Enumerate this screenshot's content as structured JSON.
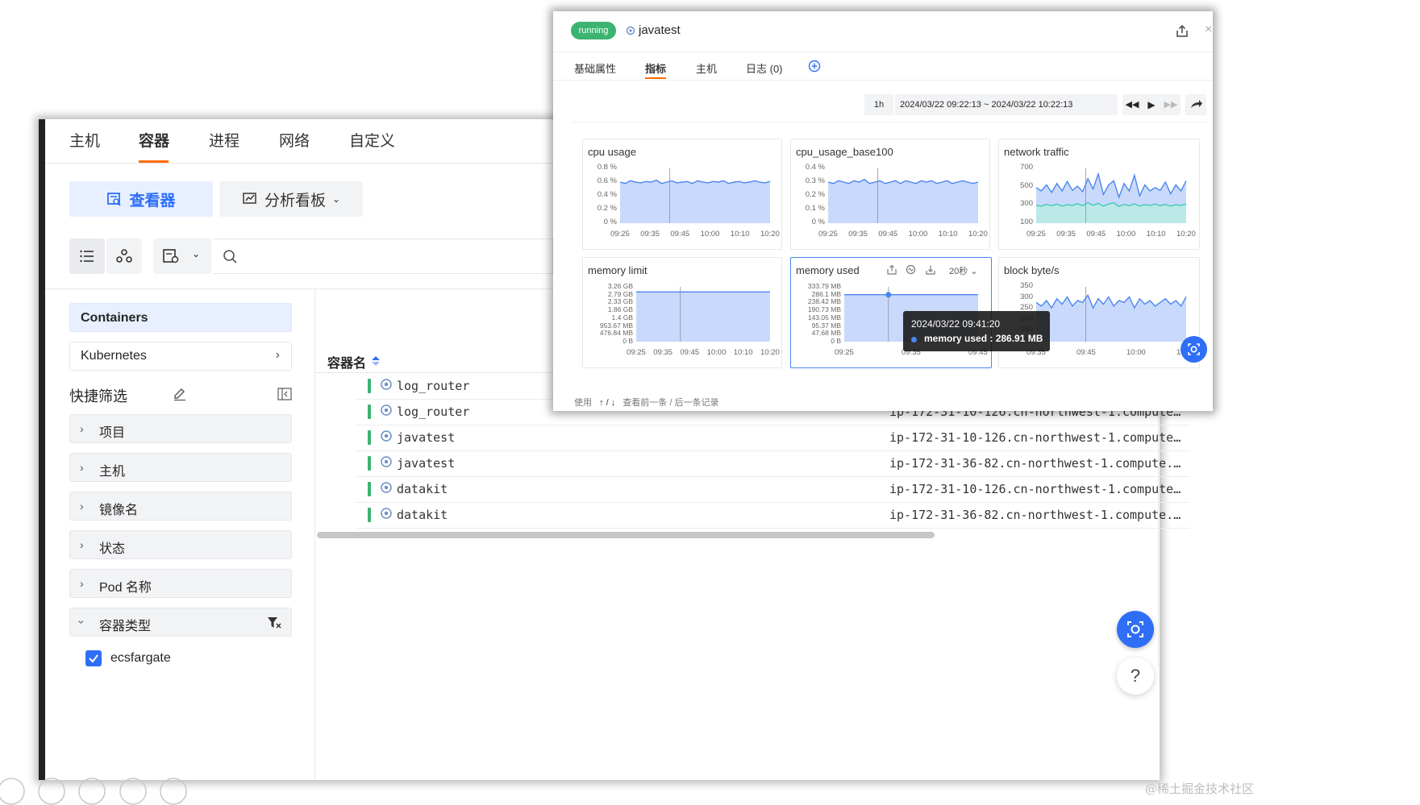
{
  "main": {
    "nav_tabs": [
      "主机",
      "容器",
      "进程",
      "网络",
      "自定义"
    ],
    "active_tab": "容器",
    "viewer_label": "查看器",
    "dashboard_label": "分析看板",
    "sidebar": {
      "section_title": "Containers",
      "kubernetes": "Kubernetes",
      "quick_filter": "快捷筛选",
      "filters": [
        "项目",
        "主机",
        "镜像名",
        "状态",
        "Pod 名称"
      ],
      "container_type": "容器类型",
      "checkbox_label": "ecsfargate",
      "checkbox_checked": true
    },
    "table": {
      "col_name": "容器名",
      "rows": [
        {
          "name": "log_router",
          "host": "ip-172-31-10-126.cn-northwest-1.compute…"
        },
        {
          "name": "log_router",
          "host": "ip-172-31-10-126.cn-northwest-1.compute…"
        },
        {
          "name": "javatest",
          "host": "ip-172-31-10-126.cn-northwest-1.compute…"
        },
        {
          "name": "javatest",
          "host": "ip-172-31-36-82.cn-northwest-1.compute.…"
        },
        {
          "name": "datakit",
          "host": "ip-172-31-10-126.cn-northwest-1.compute…"
        },
        {
          "name": "datakit",
          "host": "ip-172-31-36-82.cn-northwest-1.compute.…"
        }
      ],
      "status_color": "#3cb371"
    },
    "help": "?"
  },
  "detail": {
    "status": "running",
    "status_color": "#3cb371",
    "name": "javatest",
    "tabs": [
      "基础属性",
      "指标",
      "主机",
      "日志 (0)"
    ],
    "active_tab": "指标",
    "time_preset": "1h",
    "time_range": "2024/03/22 09:22:13 ~ 2024/03/22 10:22:13",
    "footer": {
      "prefix": "使用",
      "keys": "↑ / ↓",
      "suffix": "查看前一条 / 后一条记录"
    },
    "interval_label": "20秒",
    "tooltip": {
      "time": "2024/03/22 09:41:20",
      "label": "memory used : 286.91 MB"
    }
  },
  "chart_data": [
    {
      "type": "area",
      "title": "cpu usage",
      "x": [
        "09:25",
        "09:35",
        "09:45",
        "10:00",
        "10:10",
        "10:20"
      ],
      "yticks": [
        "0.8 %",
        "0.6 %",
        "0.4 %",
        "0.2 %",
        "0 %"
      ],
      "ylim": [
        0,
        0.8
      ],
      "series": [
        {
          "values": [
            0.6,
            0.58,
            0.62,
            0.6,
            0.59,
            0.61,
            0.6,
            0.63,
            0.58,
            0.6,
            0.62,
            0.59,
            0.6,
            0.61,
            0.58,
            0.62,
            0.6,
            0.59,
            0.61,
            0.6,
            0.62,
            0.58,
            0.6,
            0.61,
            0.59,
            0.6,
            0.62,
            0.6,
            0.59,
            0.61
          ]
        }
      ]
    },
    {
      "type": "area",
      "title": "cpu_usage_base100",
      "x": [
        "09:25",
        "09:35",
        "09:45",
        "10:00",
        "10:10",
        "10:20"
      ],
      "yticks": [
        "0.4 %",
        "0.3 %",
        "0.2 %",
        "0.1 %",
        "0 %"
      ],
      "ylim": [
        0,
        0.4
      ],
      "series": [
        {
          "values": [
            0.3,
            0.29,
            0.31,
            0.3,
            0.29,
            0.31,
            0.3,
            0.32,
            0.29,
            0.3,
            0.31,
            0.29,
            0.3,
            0.31,
            0.29,
            0.31,
            0.3,
            0.29,
            0.31,
            0.3,
            0.31,
            0.29,
            0.3,
            0.31,
            0.29,
            0.3,
            0.31,
            0.3,
            0.29,
            0.3
          ]
        }
      ]
    },
    {
      "type": "area",
      "title": "network traffic",
      "x": [
        "09:25",
        "09:35",
        "09:45",
        "10:00",
        "10:10",
        "10:20"
      ],
      "yticks": [
        "700",
        "500",
        "300",
        "100"
      ],
      "ylim": [
        0,
        800
      ],
      "series": [
        {
          "values": [
            520,
            470,
            560,
            450,
            580,
            470,
            610,
            480,
            540,
            460,
            650,
            500,
            720,
            420,
            560,
            620,
            380,
            580,
            470,
            700,
            400,
            560,
            470,
            520,
            480,
            600,
            430,
            560,
            470,
            620
          ]
        },
        {
          "values": [
            260,
            250,
            275,
            255,
            280,
            250,
            270,
            260,
            285,
            255,
            300,
            260,
            290,
            250,
            280,
            300,
            245,
            275,
            255,
            285,
            250,
            270,
            260,
            280,
            255,
            275,
            250,
            270,
            260,
            280
          ]
        }
      ]
    },
    {
      "type": "area",
      "title": "memory limit",
      "x": [
        "09:25",
        "09:35",
        "09:45",
        "10:00",
        "10:10",
        "10:20"
      ],
      "yticks": [
        "3.26 GB",
        "2.79 GB",
        "2.33 GB",
        "1.86 GB",
        "1.4 GB",
        "953.67 MB",
        "476.84 MB",
        "0 B"
      ],
      "ylim": [
        0,
        7
      ],
      "series": [
        {
          "values": [
            6.35,
            6.35,
            6.35,
            6.35,
            6.35,
            6.35,
            6.35,
            6.35,
            6.35,
            6.35
          ]
        }
      ]
    },
    {
      "type": "area",
      "title": "memory used",
      "x": [
        "09:25",
        "09:35",
        "09:45"
      ],
      "yticks": [
        "333.79 MB",
        "286.1 MB",
        "238.42 MB",
        "190.73 MB",
        "143.05 MB",
        "95.37 MB",
        "47.68 MB",
        "0 B"
      ],
      "ylim": [
        0,
        7
      ],
      "series": [
        {
          "values": [
            6.0,
            6.0,
            6.0,
            6.0,
            6.0,
            6.0,
            6.0,
            6.0,
            6.0,
            6.0
          ]
        }
      ]
    },
    {
      "type": "area",
      "title": "block byte/s",
      "x": [
        "09:35",
        "09:45",
        "10:00",
        "10:10"
      ],
      "yticks": [
        "350",
        "300",
        "250",
        "200",
        "150",
        "100"
      ],
      "ylim": [
        75,
        375
      ],
      "series": [
        {
          "values": [
            290,
            270,
            300,
            260,
            310,
            280,
            320,
            270,
            300,
            290,
            330,
            260,
            310,
            280,
            320,
            270,
            300,
            290,
            320,
            260,
            310,
            280,
            300,
            270,
            290,
            310,
            280,
            300,
            270,
            320
          ]
        }
      ]
    }
  ],
  "colors": {
    "accent": "#ff6a00",
    "primary": "#2f6ef7",
    "chart_fill": "#c9d9fb",
    "chart_line": "#4a86f0",
    "teal": "#3fc9b9",
    "active_tab_bg": "#e8f0ff"
  }
}
